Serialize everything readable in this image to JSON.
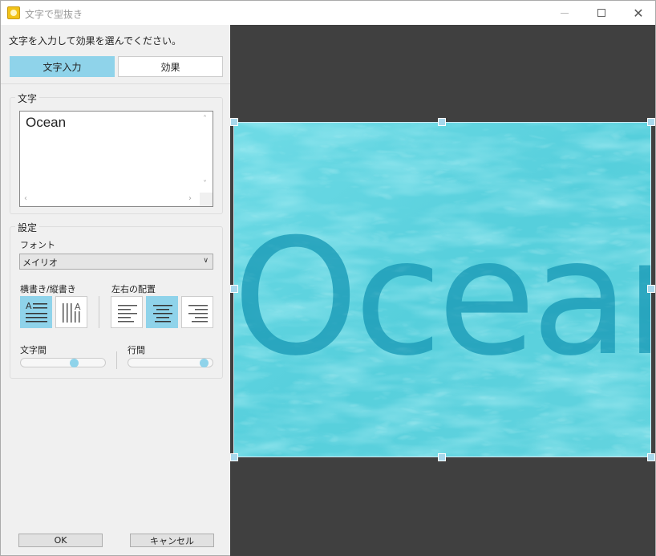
{
  "window": {
    "title": "文字で型抜き",
    "close_glyph": "✕"
  },
  "panel": {
    "instruction": "文字を入力して効果を選んでください。",
    "tabs": [
      {
        "label": "文字入力",
        "active": true
      },
      {
        "label": "効果",
        "active": false
      }
    ]
  },
  "text_group": {
    "title": "文字",
    "value": "Ocean"
  },
  "settings": {
    "title": "設定",
    "font_label": "フォント",
    "font_value": "メイリオ",
    "orientation_label": "横書き/縦書き",
    "orientation_selected": "horizontal",
    "align_label": "左右の配置",
    "align_selected": "center",
    "letter_spacing_label": "文字間",
    "letter_spacing_value": 0.65,
    "line_spacing_label": "行間",
    "line_spacing_value": 0.95
  },
  "buttons": {
    "ok": "OK",
    "cancel": "キャンセル"
  },
  "preview": {
    "text": "Ocean",
    "water_color": "#5fd3e0",
    "text_color": "#1e9db8"
  },
  "colors": {
    "accent": "#8fd3ea",
    "panel_bg": "#f0f0f0",
    "canvas_bg": "#404040"
  }
}
